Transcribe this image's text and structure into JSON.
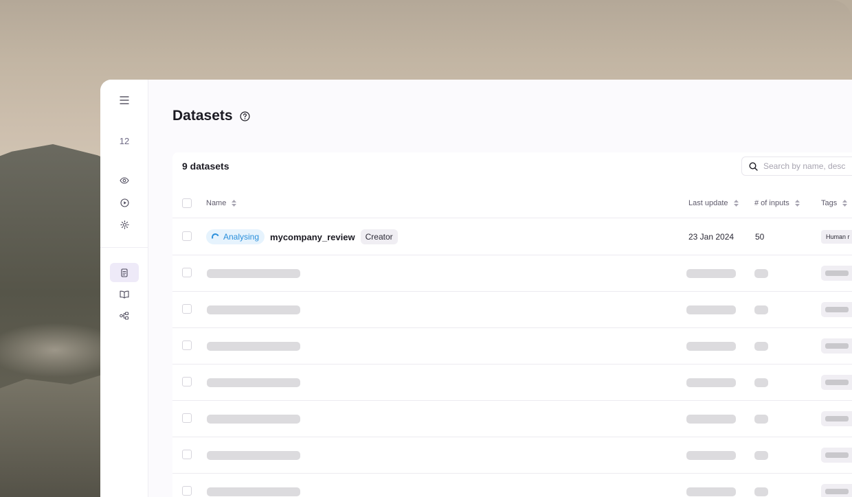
{
  "sidebar": {
    "counter": "12",
    "icons": [
      "menu-icon",
      "eye-icon",
      "play-icon",
      "settings-icon",
      "datasets-icon",
      "book-icon",
      "workflow-icon"
    ]
  },
  "header": {
    "title": "Datasets"
  },
  "toolbar": {
    "count_label": "9 datasets",
    "search_placeholder": "Search by name, desc"
  },
  "table": {
    "columns": {
      "name": "Name",
      "last_update": "Last update",
      "inputs": "# of inputs",
      "tags": "Tags"
    },
    "first_row": {
      "status": "Analysing",
      "name": "mycompany_review",
      "role": "Creator",
      "last_update": "23 Jan 2024",
      "inputs": "50",
      "tag": "Human r"
    }
  },
  "colors": {
    "accent_blue": "#2a8fdb",
    "status_bg": "#e6f3fd",
    "active_nav_bg": "#eeeaf8"
  }
}
